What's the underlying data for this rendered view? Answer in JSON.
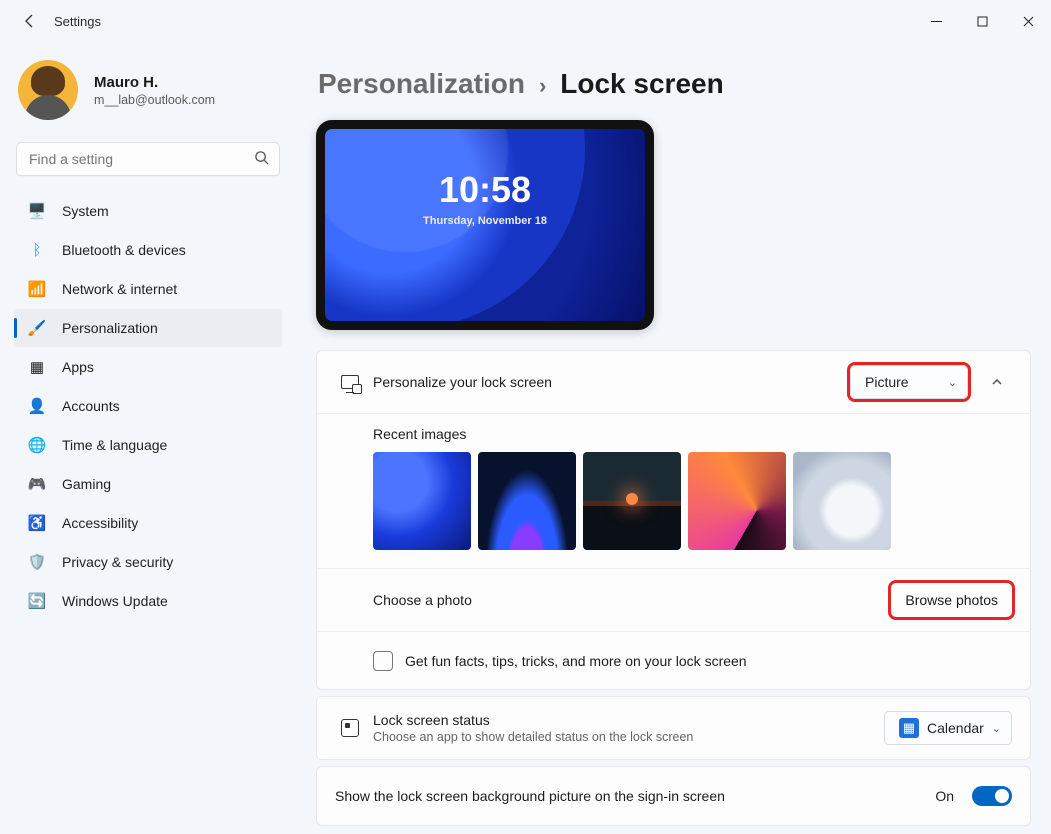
{
  "app_title": "Settings",
  "profile": {
    "name": "Mauro H.",
    "email": "m__lab@outlook.com"
  },
  "search": {
    "placeholder": "Find a setting"
  },
  "nav": [
    {
      "icon": "🖥️",
      "label": "System"
    },
    {
      "icon": "ᛒ",
      "label": "Bluetooth & devices"
    },
    {
      "icon": "📶",
      "label": "Network & internet"
    },
    {
      "icon": "🖌️",
      "label": "Personalization",
      "selected": true
    },
    {
      "icon": "▦",
      "label": "Apps"
    },
    {
      "icon": "👤",
      "label": "Accounts"
    },
    {
      "icon": "🌐",
      "label": "Time & language"
    },
    {
      "icon": "🎮",
      "label": "Gaming"
    },
    {
      "icon": "♿",
      "label": "Accessibility"
    },
    {
      "icon": "🛡️",
      "label": "Privacy & security"
    },
    {
      "icon": "🔄",
      "label": "Windows Update"
    }
  ],
  "breadcrumb": {
    "parent": "Personalization",
    "sep": "›",
    "current": "Lock screen"
  },
  "preview": {
    "time": "10:58",
    "date": "Thursday, November 18"
  },
  "personalize": {
    "title": "Personalize your lock screen",
    "dropdown_value": "Picture",
    "recent_label": "Recent images",
    "choose_label": "Choose a photo",
    "browse_button": "Browse photos",
    "fun_facts": "Get fun facts, tips, tricks, and more on your lock screen"
  },
  "status": {
    "title": "Lock screen status",
    "subtitle": "Choose an app to show detailed status on the lock screen",
    "app": "Calendar"
  },
  "signin_bg": {
    "title": "Show the lock screen background picture on the sign-in screen",
    "state_label": "On"
  }
}
